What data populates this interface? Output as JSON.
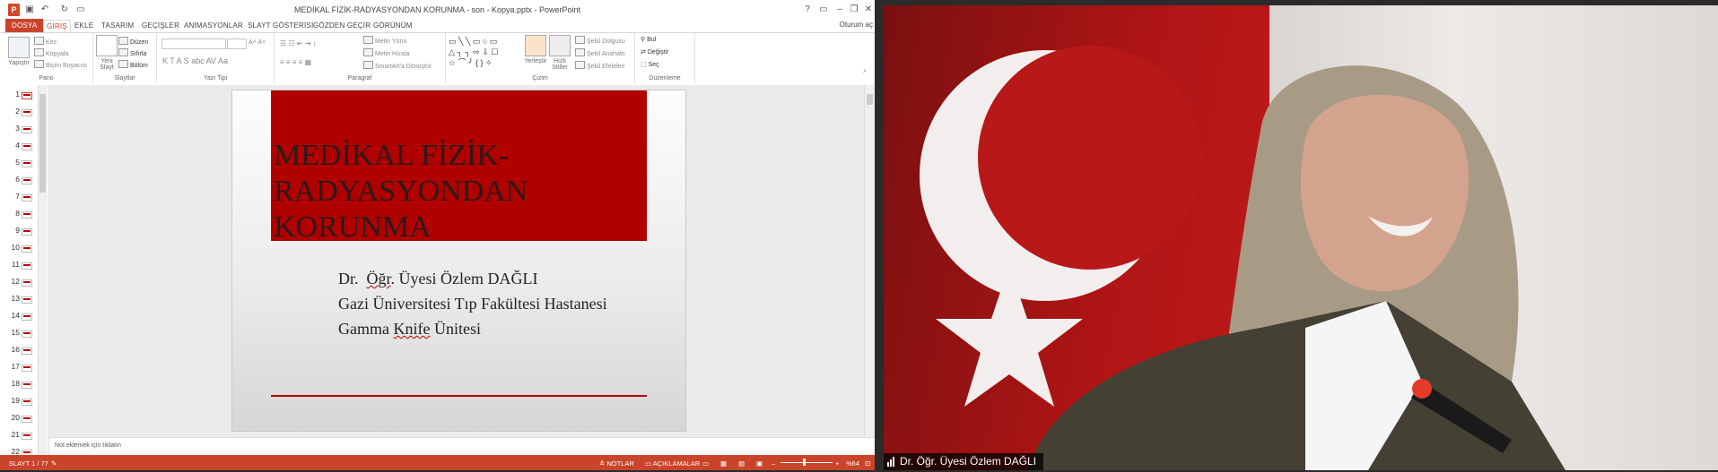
{
  "window": {
    "title": "MEDİKAL FİZİK-RADYASYONDAN KORUNMA - son - Kopya.pptx - PowerPoint",
    "login": "Oturum aç"
  },
  "tabs": [
    "DOSYA",
    "GİRİŞ",
    "EKLE",
    "TASARIM",
    "GEÇİŞLER",
    "ANİMASYONLAR",
    "SLAYT GÖSTERİSİ",
    "GÖZDEN GEÇİR",
    "GÖRÜNÜM"
  ],
  "ribbon": {
    "pano": {
      "label": "Pano",
      "paste": "Yapıştır",
      "cut": "Kes",
      "copy": "Kopyala",
      "painter": "Biçim Boyacısı"
    },
    "slaytlar": {
      "label": "Slaytlar",
      "new": "Yeni Slayt",
      "layout": "Düzen",
      "reset": "Sıfırla",
      "section": "Bölüm"
    },
    "yazitipi": {
      "label": "Yazı Tipi"
    },
    "paragraf": {
      "label": "Paragraf",
      "direction": "Metin Yönü",
      "align": "Metin Hizala",
      "smartart": "SmartArt'a Dönüştür"
    },
    "cizim": {
      "label": "Çizim",
      "arrange": "Yerleştir",
      "quick": "Hızlı Stiller",
      "fill": "Şekil Dolgusu",
      "outline": "Şekil Anahattı",
      "effects": "Şekil Efektleri"
    },
    "duzenleme": {
      "label": "Düzenleme",
      "find": "Bul",
      "replace": "Değiştir",
      "select": "Seç"
    }
  },
  "thumbs": [
    "1",
    "2",
    "3",
    "4",
    "5",
    "6",
    "7",
    "8",
    "9",
    "10",
    "11",
    "12",
    "13",
    "14",
    "15",
    "16",
    "17",
    "18",
    "19",
    "20",
    "21",
    "22"
  ],
  "slide": {
    "title_lines": [
      "MEDİKAL FİZİK-",
      "RADYASYONDAN",
      "KORUNMA"
    ],
    "sub1_a": "Dr.  ",
    "sub1_b": "Öğr",
    "sub1_c": ". Üyesi Özlem DAĞLI",
    "sub2": "Gazi Üniversitesi Tıp Fakültesi Hastanesi",
    "sub3_a": "Gamma ",
    "sub3_b": "Knife",
    "sub3_c": " Ünitesi"
  },
  "notes": "Not eklemek için tıklatın",
  "status": {
    "slide": "SLAYT 1 / 77",
    "notes": "NOTLAR",
    "comments": "AÇIKLAMALAR",
    "zoom": "%64"
  },
  "participant": "Dr. Öğr. Üyesi Özlem DAĞLI",
  "colors": {
    "accent": "#c9442a",
    "slide_red": "#b00000"
  }
}
